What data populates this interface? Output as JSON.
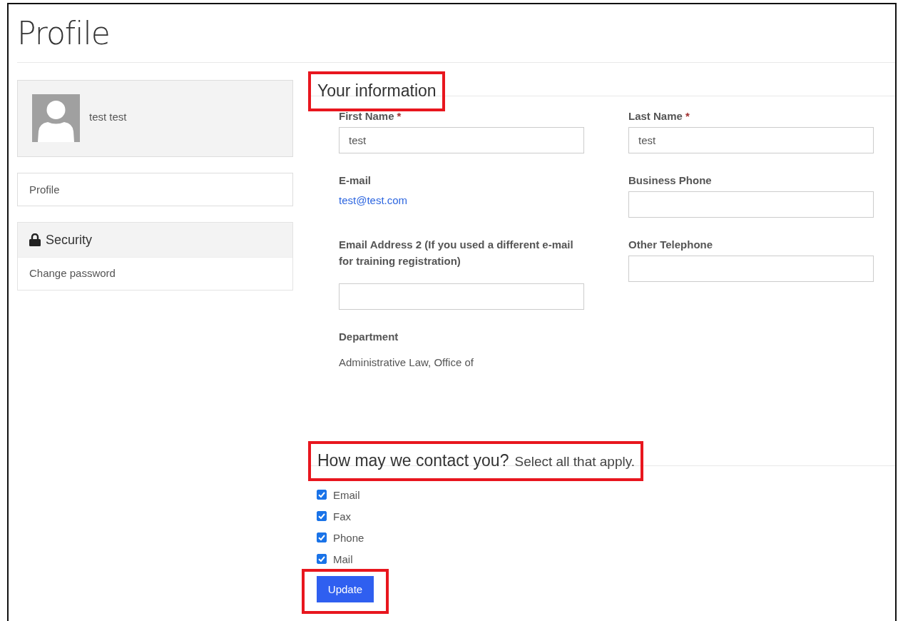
{
  "page_title": "Profile",
  "user_card": {
    "name": "test test"
  },
  "nav": [
    {
      "label": "Profile",
      "selected": false
    }
  ],
  "security": {
    "title": "Security",
    "items": [
      {
        "label": "Change password"
      }
    ]
  },
  "info_section": {
    "heading": "Your information",
    "highlighted": true
  },
  "fields": [
    {
      "kind": "input",
      "label": "First Name",
      "required_mark": "*",
      "value": "test"
    },
    {
      "kind": "input",
      "label": "Last Name",
      "required_mark": "*",
      "value": "test"
    },
    {
      "kind": "link",
      "label": "E-mail",
      "value": "test@test.com"
    },
    {
      "kind": "input",
      "label": "Business Phone"
    },
    {
      "kind": "input",
      "label": "Email Address 2 (If you used a different e-mail for training registration)"
    },
    {
      "kind": "input",
      "label": "Other Telephone"
    },
    {
      "kind": "text",
      "label": "Department",
      "value": "Administrative Law, Office of"
    }
  ],
  "contact_section": {
    "heading": "How may we contact you?",
    "hint": "Select all that apply.",
    "highlighted": true
  },
  "contact_options": [
    {
      "label": "Email",
      "checked": true
    },
    {
      "label": "Fax",
      "checked": true
    },
    {
      "label": "Phone",
      "checked": true
    },
    {
      "label": "Mail",
      "checked": true
    }
  ],
  "update_button": {
    "label": "Update",
    "highlighted": true
  }
}
